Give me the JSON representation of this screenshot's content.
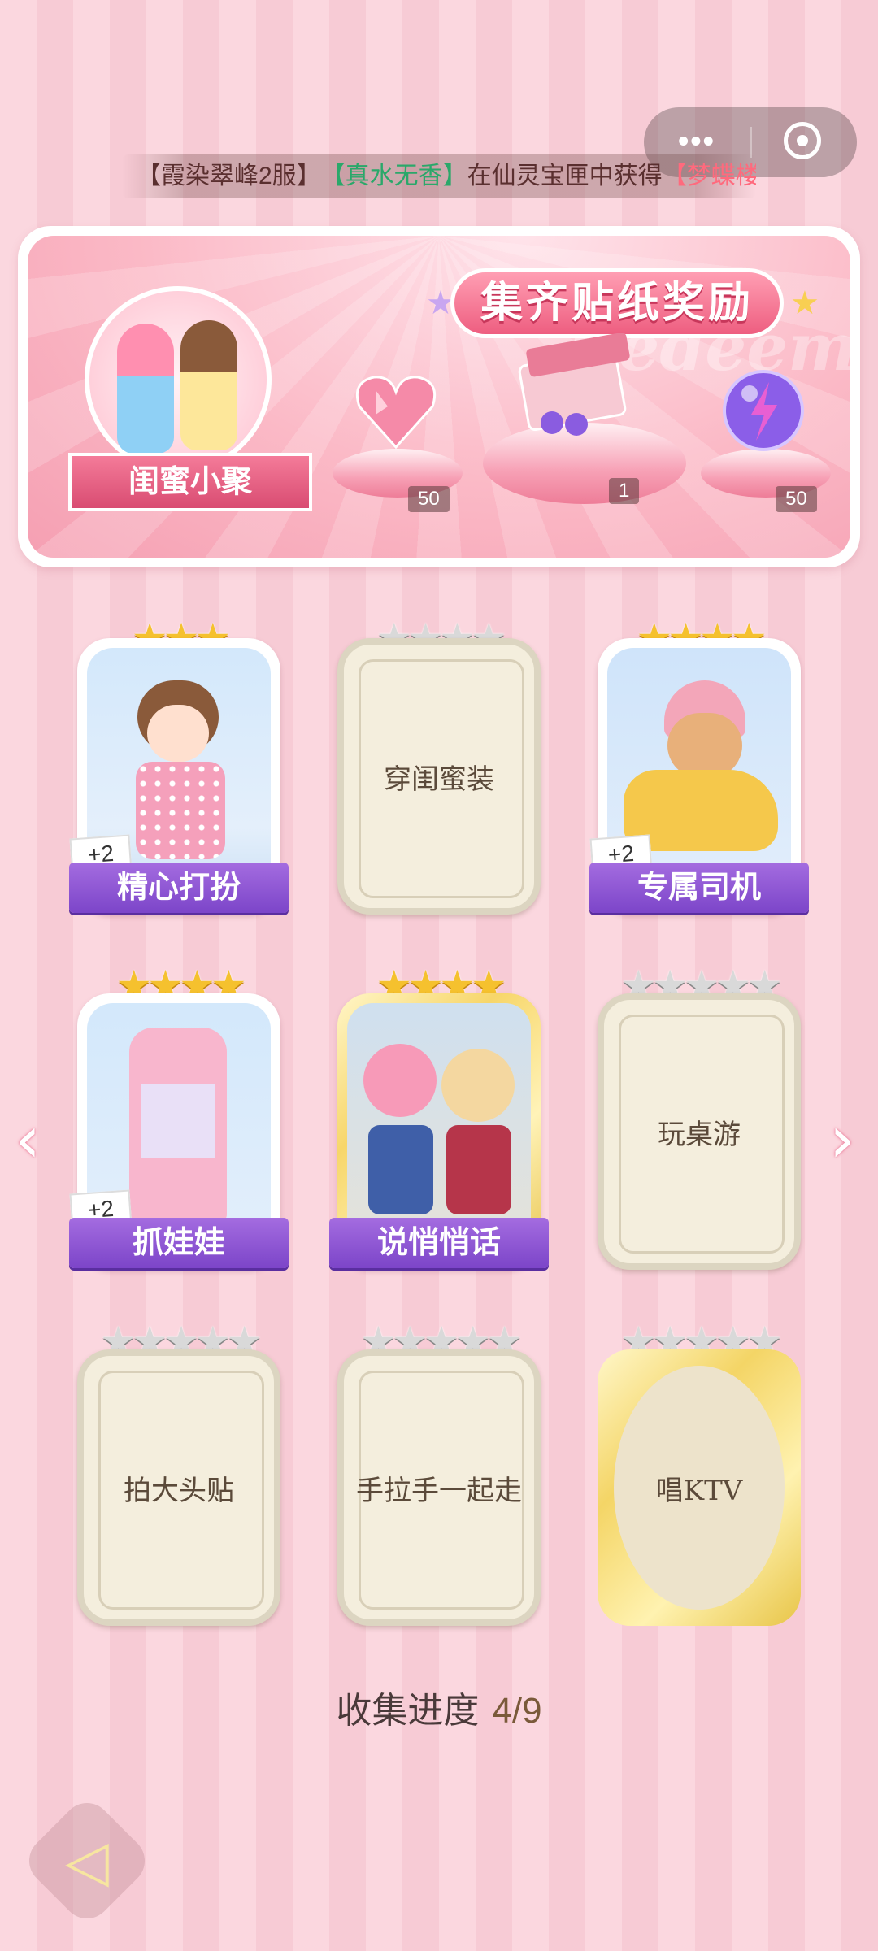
{
  "broadcast": {
    "server": "【霞染翠峰2服】",
    "player": "【真水无香】",
    "text": "在仙灵宝匣中获得",
    "item": "【梦蝶楼"
  },
  "banner": {
    "title": "集齐贴纸奖励",
    "watermark": "Redeem",
    "theme_label": "闺蜜小聚",
    "rewards": [
      {
        "icon": "heart-gem-icon",
        "count": "50"
      },
      {
        "icon": "gift-box-icon",
        "count": "1"
      },
      {
        "icon": "lightning-orb-icon",
        "count": "50"
      }
    ]
  },
  "cards": [
    {
      "name": "精心打扮",
      "unlocked": true,
      "stars": 3,
      "bonus": "+2",
      "frame": "white"
    },
    {
      "name": "穿闺蜜装",
      "unlocked": false,
      "stars": 4,
      "frame": "locked"
    },
    {
      "name": "专属司机",
      "unlocked": true,
      "stars": 4,
      "bonus": "+2",
      "frame": "white"
    },
    {
      "name": "抓娃娃",
      "unlocked": true,
      "stars": 4,
      "bonus": "+2",
      "frame": "white"
    },
    {
      "name": "说悄悄话",
      "unlocked": true,
      "stars": 4,
      "frame": "gold"
    },
    {
      "name": "玩桌游",
      "unlocked": false,
      "stars": 5,
      "frame": "locked"
    },
    {
      "name": "拍大头贴",
      "unlocked": false,
      "stars": 5,
      "frame": "locked"
    },
    {
      "name": "手拉手一起走",
      "unlocked": false,
      "stars": 5,
      "frame": "locked"
    },
    {
      "name": "唱KTV",
      "unlocked": false,
      "stars": 5,
      "frame": "gold-locked"
    }
  ],
  "progress": {
    "label": "收集进度",
    "value": "4/9",
    "collected": 4,
    "total": 9
  },
  "nav": {
    "prev_icon": "chevron-left-icon",
    "next_icon": "chevron-right-icon",
    "back_icon": "back-arrow-icon"
  }
}
